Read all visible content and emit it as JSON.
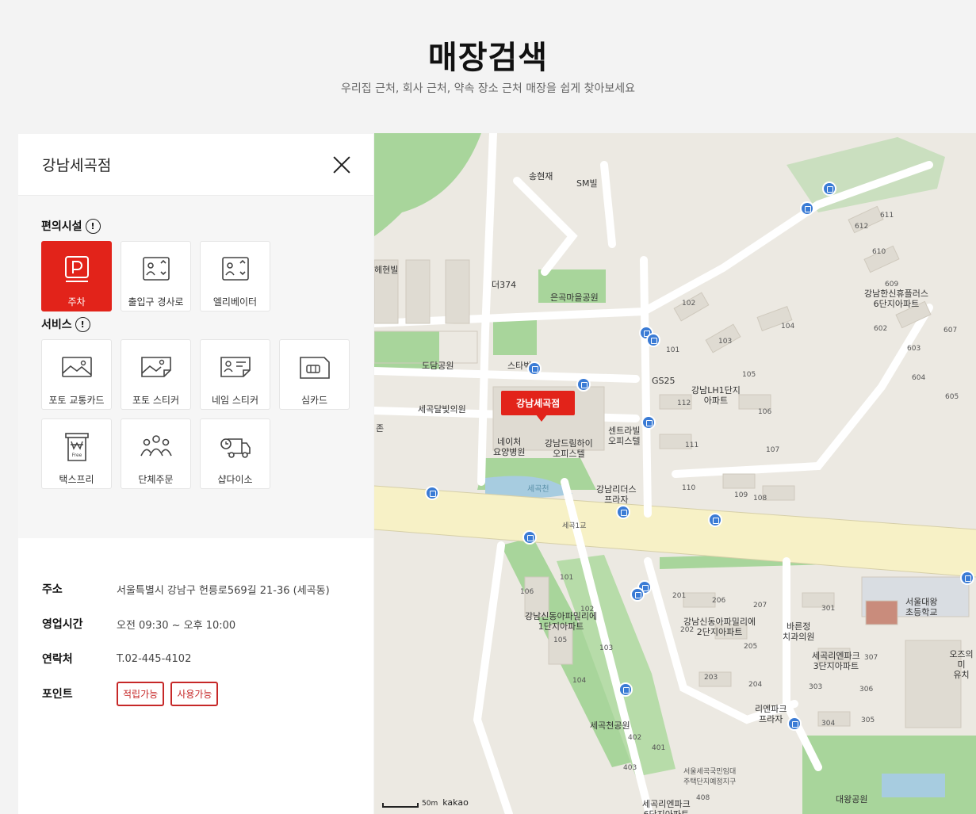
{
  "header": {
    "title": "매장검색",
    "subtitle": "우리집 근처, 회사 근처, 약속 장소 근처 매장을 쉽게 찾아보세요"
  },
  "store": {
    "name": "강남세곡점",
    "facilities_label": "편의시설",
    "services_label": "서비스",
    "facilities": [
      {
        "label": "주차",
        "icon": "parking-icon",
        "active": true
      },
      {
        "label": "출입구 경사로",
        "icon": "ramp-icon",
        "active": false
      },
      {
        "label": "엘리베이터",
        "icon": "elevator-icon",
        "active": false
      }
    ],
    "services": [
      {
        "label": "포토 교통카드",
        "icon": "photo-card-icon"
      },
      {
        "label": "포토 스티커",
        "icon": "photo-sticker-icon"
      },
      {
        "label": "네임 스티커",
        "icon": "name-sticker-icon"
      },
      {
        "label": "심카드",
        "icon": "sim-card-icon"
      },
      {
        "label": "택스프리",
        "icon": "tax-free-icon"
      },
      {
        "label": "단체주문",
        "icon": "group-order-icon"
      },
      {
        "label": "샵다이소",
        "icon": "delivery-truck-icon"
      }
    ],
    "details": {
      "address_label": "주소",
      "address": "서울특별시 강남구 헌릉로569길 21-36 (세곡동)",
      "hours_label": "영업시간",
      "hours": "오전 09:30 ~ 오후 10:00",
      "contact_label": "연락처",
      "contact": "T.02-445-4102",
      "points_label": "포인트",
      "points_earn": "적립가능",
      "points_use": "사용가능"
    }
  },
  "map": {
    "marker": "강남세곡점",
    "scale": "50m",
    "provider": "kakao",
    "places": {
      "songhyunjae": "송현재",
      "smbill": "SM빌",
      "hyunbill": "헤현빌",
      "d374": "더374",
      "eungok_park": "은곡마을공원",
      "dodam_park": "도담공원",
      "starbucks": "스타벅",
      "gs25": "GS25",
      "lh1": "강남LH1단지\n아파트",
      "daleun": "세곡달빛의원",
      "jon": "존",
      "nature": "네이처\n요양병원",
      "dream": "강남드림하이\n오피스텔",
      "central": "센트라빌\n오피스텔",
      "hanshin": "강남한신휴플러스\n6단지아파트",
      "segokcheon": "세곡천",
      "leaders": "강남리더스\n프라자",
      "segok_bridge": "세곡1교",
      "family1": "강남신동아파밀리에\n1단지아파트",
      "family2": "강남신동아파밀리에\n2단지아파트",
      "bareun": "바른정\n치과의원",
      "leenpark3": "세곡리엔파크\n3단지아파트",
      "daewang_school": "서울대왕\n초등학교",
      "ozz": "오즈의미\n유치",
      "leenpark_plaza": "리엔파크\n프라자",
      "segok_park": "세곡천공원",
      "daewang_park": "대왕공원",
      "gukmin": "서울세곡국민임대\n주택단지예정지구",
      "leenpark_bottom": "세곡리엔파크\n6단지아파트"
    },
    "buildings": {
      "b101": "101",
      "b102": "102",
      "b103": "103",
      "b104": "104",
      "b105": "105",
      "b106": "106",
      "b107": "107",
      "b108": "108",
      "b109": "109",
      "b110": "110",
      "b111": "111",
      "b112": "112",
      "b602": "602",
      "b603": "603",
      "b604": "604",
      "b605": "605",
      "b607": "607",
      "b609": "609",
      "b610": "610",
      "b611": "611",
      "b612": "612",
      "c101": "101",
      "c102": "102",
      "c103": "103",
      "c104": "104",
      "c105": "105",
      "c106": "106",
      "d201": "201",
      "d202": "202",
      "d203": "203",
      "d204": "204",
      "d205": "205",
      "d206": "206",
      "d207": "207",
      "e301": "301",
      "e303": "303",
      "e304": "304",
      "e305": "305",
      "e306": "306",
      "e307": "307",
      "f401": "401",
      "f402": "402",
      "f403": "403",
      "f408": "408"
    }
  }
}
